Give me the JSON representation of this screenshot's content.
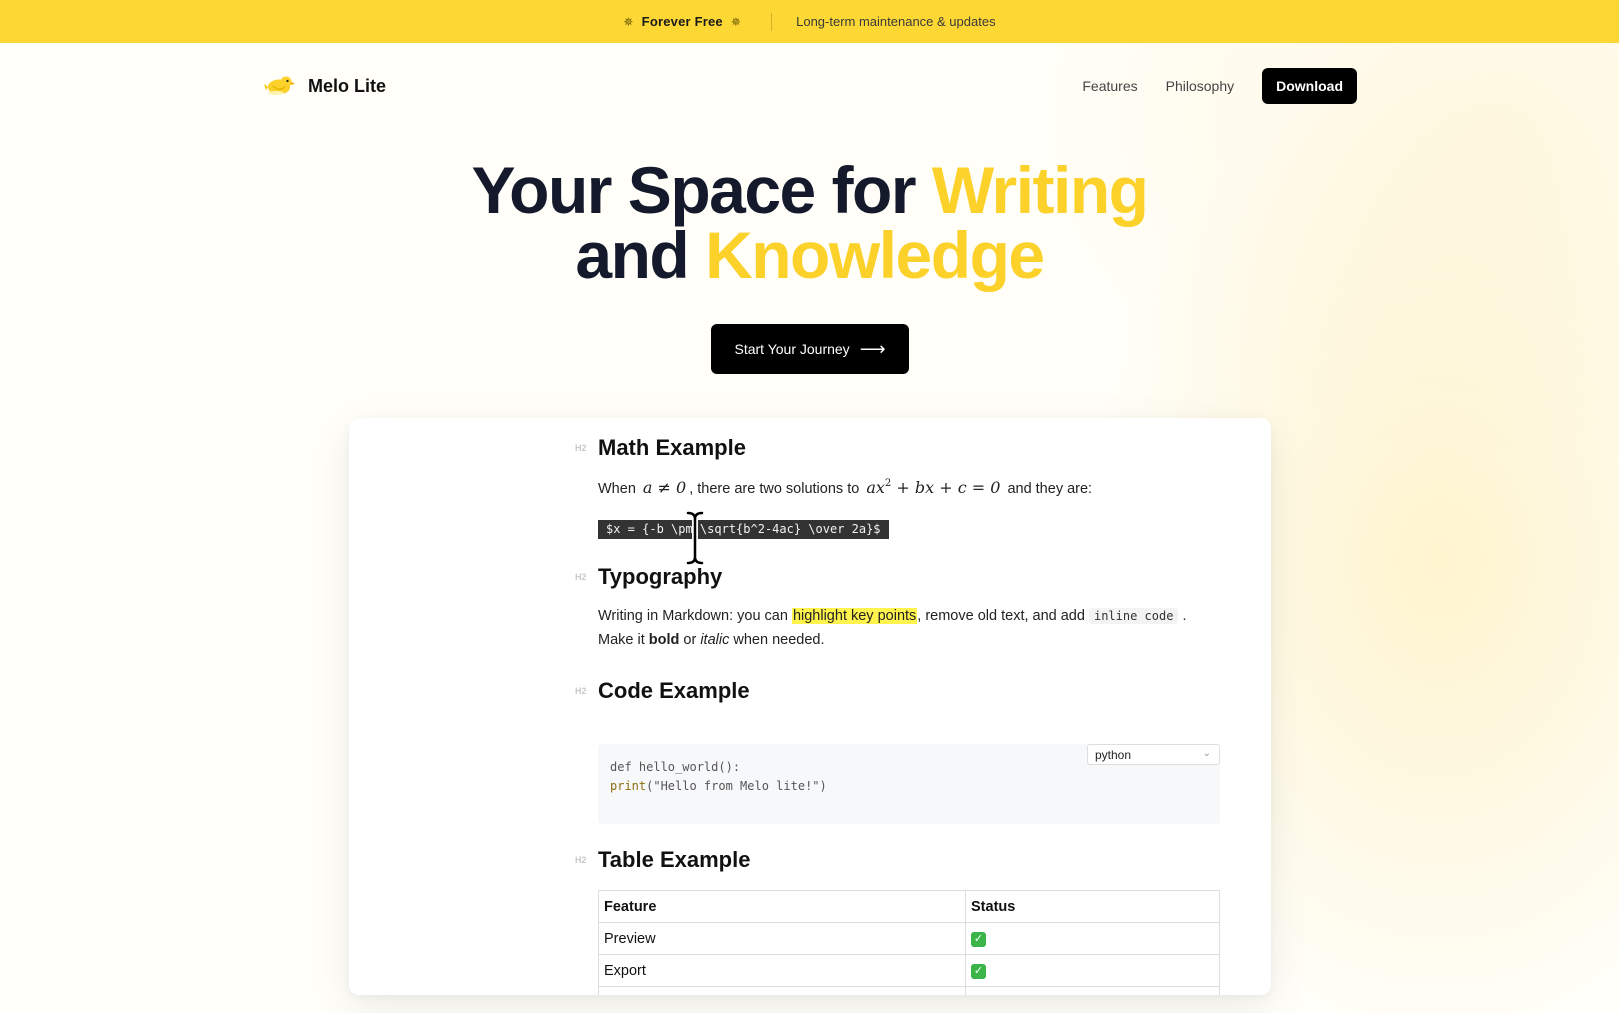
{
  "banner": {
    "free_label": "Forever Free",
    "maint_label": "Long-term maintenance & updates",
    "spark_glyph": "✵"
  },
  "nav": {
    "brand": "Melo Lite",
    "links": [
      "Features",
      "Philosophy"
    ],
    "download": "Download"
  },
  "hero": {
    "line1_a": "Your Space for ",
    "line1_b": "Writing",
    "line2_a": "and ",
    "line2_b": "Knowledge",
    "cta": "Start Your Journey",
    "cta_arrow": "⟶"
  },
  "editor": {
    "h2_tag": "H2",
    "math": {
      "heading": "Math Example",
      "p_when": "When",
      "p_a": "a ≠ 0",
      "p_mid": ", there are two solutions to",
      "p_eq_a": "ax",
      "p_eq_sup": "2",
      "p_eq_b": " + bx + c = 0",
      "p_end": "and they are:",
      "latex": "$x = {-b \\pm \\sqrt{b^2-4ac} \\over 2a}$"
    },
    "typo": {
      "heading": "Typography",
      "l1_a": "Writing in Markdown: you can ",
      "l1_mark": "highlight key points",
      "l1_b": ", remove old text, and add ",
      "l1_code": "inline code",
      "l1_c": " .",
      "l2_a": "Make it ",
      "l2_bold": "bold",
      "l2_b": " or ",
      "l2_italic": "italic",
      "l2_c": " when needed."
    },
    "code": {
      "heading": "Code Example",
      "language": "python",
      "line1": "def hello_world():",
      "line2_kw": "print",
      "line2_rest": "(\"Hello from Melo lite!\")"
    },
    "table": {
      "heading": "Table Example",
      "headers": [
        "Feature",
        "Status"
      ],
      "rows": [
        {
          "feature": "Preview",
          "status": "✓"
        },
        {
          "feature": "Export",
          "status": "✓"
        }
      ]
    }
  },
  "colors": {
    "banner": "#fdd835",
    "accent": "#fcd12a",
    "ink": "#141a2b"
  }
}
